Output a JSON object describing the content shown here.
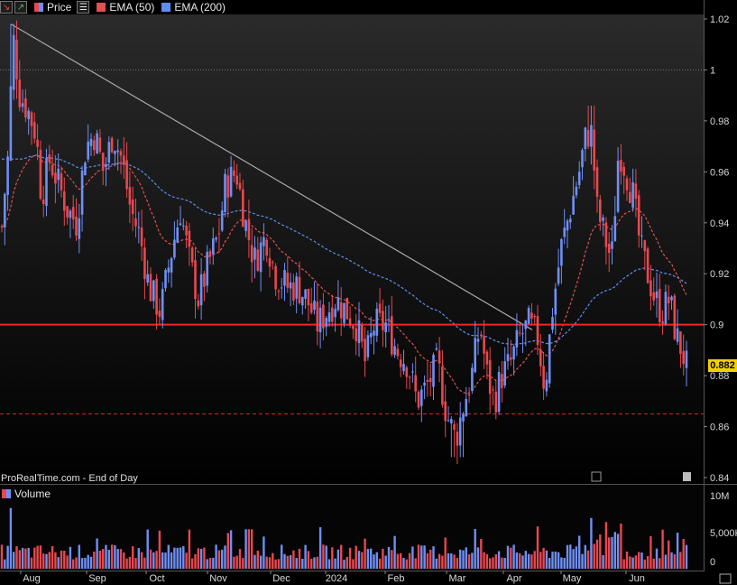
{
  "toolbar": {
    "price_label": "Price",
    "ema50_label": "EMA (50)",
    "ema200_label": "EMA (200)",
    "ema50_color": "#e05050",
    "ema200_color": "#5b8ef0"
  },
  "volume_panel": {
    "label": "Volume",
    "ticks": [
      "10M",
      "5,000K",
      "0"
    ]
  },
  "watermark": "ProRealTime.com - End of Day",
  "current_price": "0.882",
  "price_ticks": [
    "1.02",
    "1",
    "0.98",
    "0.96",
    "0.94",
    "0.92",
    "0.9",
    "0.88",
    "0.86",
    "0.84"
  ],
  "month_labels": [
    "Aug",
    "Sep",
    "Oct",
    "Nov",
    "Dec",
    "2024",
    "Feb",
    "Mar",
    "Apr",
    "May",
    "Jun"
  ],
  "colors": {
    "up": "#6f8ff5",
    "down": "#e8484e",
    "support_line": "#ff2020",
    "trendline": "#aaaaaa"
  },
  "chart_data": {
    "type": "candlestick",
    "ylim": [
      0.84,
      1.02
    ],
    "support_level": 0.9,
    "dashed_level": 0.865,
    "dotted_level": 1.0,
    "trendline": {
      "from": [
        "Aug",
        1.018
      ],
      "to": [
        "Apr",
        0.898
      ]
    },
    "closes_approx": [
      {
        "month": "Aug",
        "price": 1.01
      },
      {
        "month": "Sep",
        "price": 0.975
      },
      {
        "month": "Oct",
        "price": 0.93
      },
      {
        "month": "Nov",
        "price": 0.955
      },
      {
        "month": "Dec",
        "price": 0.905
      },
      {
        "month": "2024",
        "price": 0.91
      },
      {
        "month": "Feb",
        "price": 0.885
      },
      {
        "month": "Mar",
        "price": 0.87
      },
      {
        "month": "Apr",
        "price": 0.895
      },
      {
        "month": "May",
        "price": 0.975
      },
      {
        "month": "Jun",
        "price": 0.91
      },
      {
        "month": "end",
        "price": 0.882
      }
    ]
  }
}
